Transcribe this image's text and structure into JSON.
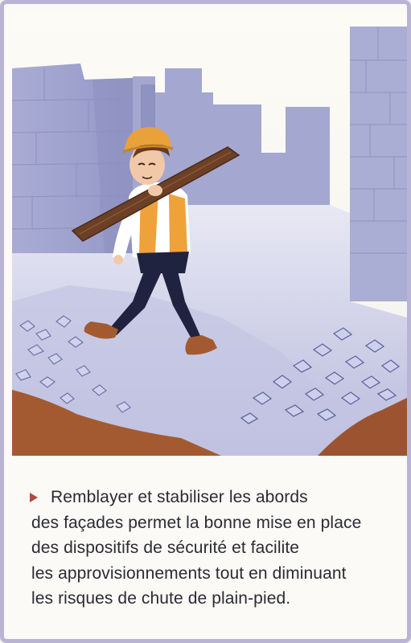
{
  "caption": {
    "lines": [
      "Remblayer et stabiliser les abords",
      "des façades permet la bonne mise en place",
      "des dispositifs de sécurité et facilite",
      "les approvisionnements tout en diminuant",
      "les risques de chute de plain-pied."
    ]
  },
  "colors": {
    "frame": "#b9b4d6",
    "bullet": "#b04a3a",
    "wall": "#9fa3cc",
    "ground": "#c9cbe6",
    "dirt": "#a5582e",
    "helmet": "#e9a13a",
    "plank": "#6b4026",
    "vest": "#f0a23a",
    "trousers": "#1f2340"
  },
  "icons": {
    "bullet": "triangle-right-icon"
  }
}
